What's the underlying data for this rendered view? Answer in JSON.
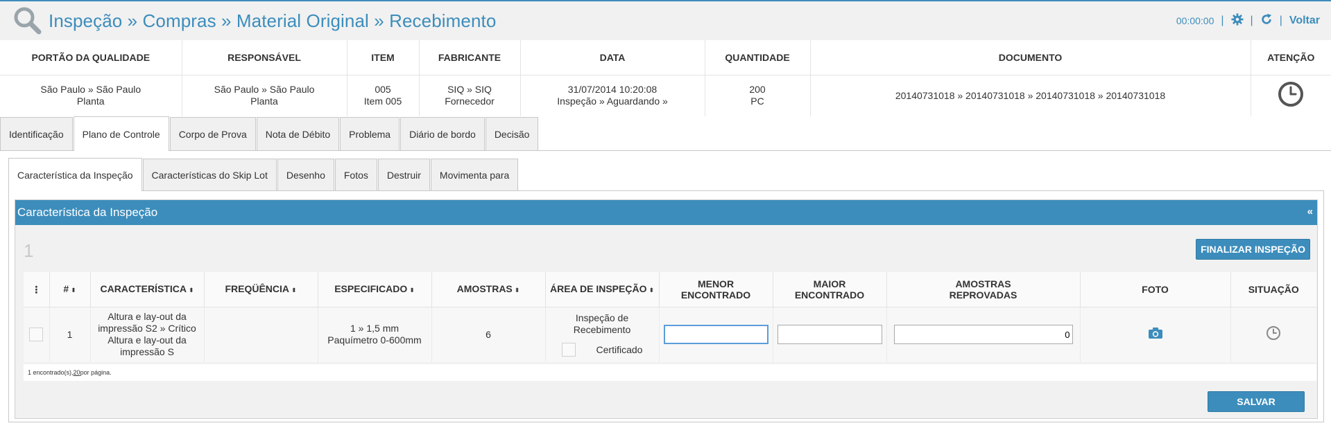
{
  "header": {
    "title": "Inspeção » Compras » Material Original » Recebimento",
    "timer": "00:00:00",
    "separator": "|",
    "back_label": "Voltar"
  },
  "summary": {
    "columns": [
      "PORTÃO DA QUALIDADE",
      "RESPONSÁVEL",
      "ITEM",
      "FABRICANTE",
      "DATA",
      "QUANTIDADE",
      "DOCUMENTO",
      "ATENÇÃO"
    ],
    "values": {
      "portao": [
        "São Paulo » São Paulo",
        "Planta"
      ],
      "responsavel": [
        "São Paulo » São Paulo",
        "Planta"
      ],
      "item": [
        "005",
        "Item 005"
      ],
      "fabricante": [
        "SIQ » SIQ",
        "Fornecedor"
      ],
      "data": [
        "31/07/2014 10:20:08",
        "Inspeção » Aguardando »"
      ],
      "quantidade": [
        "200",
        "PC"
      ],
      "documento": "20140731018 » 20140731018 » 20140731018 » 20140731018"
    }
  },
  "tabs": [
    "Identificação",
    "Plano de Controle",
    "Corpo de Prova",
    "Nota de Débito",
    "Problema",
    "Diário de bordo",
    "Decisão"
  ],
  "subtabs": [
    "Característica da Inspeção",
    "Características do Skip Lot",
    "Desenho",
    "Fotos",
    "Destruir",
    "Movimenta para"
  ],
  "panel": {
    "title": "Característica da Inspeção",
    "collapse": "«",
    "count": "1",
    "finalize_label": "FINALIZAR INSPEÇÃO",
    "save_label": "SALVAR"
  },
  "grid": {
    "headers": {
      "menu": "⋮",
      "num": "#",
      "caracteristica": "CARACTERÍSTICA",
      "frequencia": "FREQÜÊNCIA",
      "especificado": "ESPECIFICADO",
      "amostras": "AMOSTRAS",
      "area": "ÁREA DE INSPEÇÃO",
      "menor": [
        "MENOR",
        "ENCONTRADO"
      ],
      "maior": [
        "MAIOR",
        "ENCONTRADO"
      ],
      "reprovadas": [
        "AMOSTRAS",
        "REPROVADAS"
      ],
      "foto": "FOTO",
      "situacao": "SITUAÇÃO"
    },
    "rows": [
      {
        "num": "1",
        "caracteristica": [
          "Altura e lay-out da",
          "impressão S2 » Crítico",
          "Altura e lay-out da",
          "impressão S"
        ],
        "frequencia": "",
        "especificado": [
          "1 » 1,5 mm",
          "Paquímetro 0-600mm"
        ],
        "amostras": "6",
        "area": [
          "Inspeção de",
          "Recebimento"
        ],
        "certificado": "Certificado",
        "menor": "",
        "maior": "",
        "reprovadas": "0"
      }
    ],
    "footer": {
      "found": "1 encontrado(s), ",
      "per_page_num": "20",
      "per_page_suffix": " por página."
    }
  },
  "colors": {
    "accent": "#3c8dbc",
    "header_bg": "#f1f1f1"
  },
  "icons": {
    "header": "search-icon",
    "settings": "gear-icon",
    "refresh": "refresh-icon",
    "attention": "clock-icon",
    "photo": "camera-icon",
    "status": "clock-icon"
  }
}
